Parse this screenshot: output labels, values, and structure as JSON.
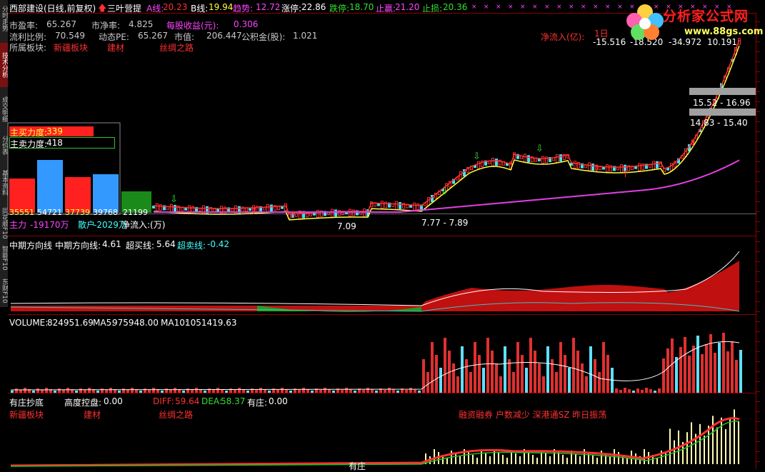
{
  "header": {
    "stock_name": "西部建设(日线,前复权)",
    "arrow_label": "三叶营提",
    "a_line_label": "A线:",
    "a_line_value": "20.23",
    "b_line_label": "B线:",
    "b_line_value": "19.94",
    "trend_label": "趋势:",
    "trend_value": "12.72",
    "limit_up_label": "涨停:",
    "limit_up_value": "22.86",
    "limit_down_label": "跌停:",
    "limit_down_value": "18.70",
    "take_profit_label": "止赢:",
    "take_profit_value": "21.20",
    "stop_loss_label": "止损:",
    "stop_loss_value": "20.36"
  },
  "info": {
    "pe_label": "市盈率:",
    "pe_value": "65.267",
    "pb_label": "市净率:",
    "pb_value": "4.825",
    "eps_label": "每股收益(元):",
    "eps_value": "0.306",
    "float_label": "流利比例:",
    "float_value": "70.549",
    "dpe_label": "动态PE:",
    "dpe_value": "65.267",
    "mcap_label": "市值:",
    "mcap_value": "206.447",
    "fund_label": "公积金(股):",
    "fund_value": "1.021",
    "sector_label": "所属板块:",
    "sectors": [
      "新疆板块",
      "建材",
      "丝绸之路"
    ]
  },
  "netflow": {
    "label": "净流入(亿):",
    "period": "1日",
    "values": [
      "-15.516",
      "-18.520",
      "-34.972",
      "10.191"
    ]
  },
  "price_labels": [
    "15.52 - 16.96",
    "14.83 - 15.40",
    "7.77 - 7.89",
    "7.09"
  ],
  "force_panel": {
    "buy_label": "主买力度:",
    "buy_value": "339",
    "sell_label": "主卖力度:",
    "sell_value": "418",
    "bars": [
      "35551",
      "54721",
      "37739",
      "39768",
      "21199"
    ],
    "bar_colors": [
      "#ff2020",
      "#3399ff",
      "#ff2020",
      "#3399ff",
      "#1a8a1a"
    ],
    "main_label": "主力",
    "main_value": "-19170万",
    "retail_label": "散户",
    "retail_value": "-2029万",
    "net_label": "净流入:(万)"
  },
  "mid_panel": {
    "title": "中期方向线",
    "line_label": "中期方向线:",
    "line_value": "4.61",
    "overbuy_label": "超买线:",
    "overbuy_value": "5.64",
    "oversell_label": "超卖线:",
    "oversell_value": "-0.42"
  },
  "volume_panel": {
    "vol_label": "VOLUME:",
    "vol_value": "824951.69",
    "ma5_label": "MA5:",
    "ma5_value": "975948.00",
    "ma10_label": "MA10:",
    "ma10_value": "1051419.63"
  },
  "bottom_panel": {
    "title": "有庄抄底",
    "ctrl_label": "高度控盘:",
    "ctrl_value": "0.00",
    "diff_label": "DIFF:",
    "diff_value": "59.64",
    "dea_label": "DEA:",
    "dea_value": "58.37",
    "zhuang_label": "有庄:",
    "zhuang_value": "0.00",
    "sectors": [
      "新疆板块",
      "建材",
      "丝绸之路"
    ],
    "tags": "融资融券 户数减少 深港通SZ 昨日振荡",
    "bottom_text": "有庄"
  },
  "side_tabs": [
    "分时走势",
    "技术分析",
    "成交明细",
    "分价表",
    "基本资料",
    "同花顺F10",
    "智能F10",
    "东财F10"
  ],
  "logo": {
    "name": "分析家公式网",
    "url": "www.88gs.com"
  },
  "colors": {
    "up": "#ff3030",
    "down": "#40e0ff",
    "ma_yellow": "#ffff40",
    "ma_magenta": "#e040e0"
  }
}
